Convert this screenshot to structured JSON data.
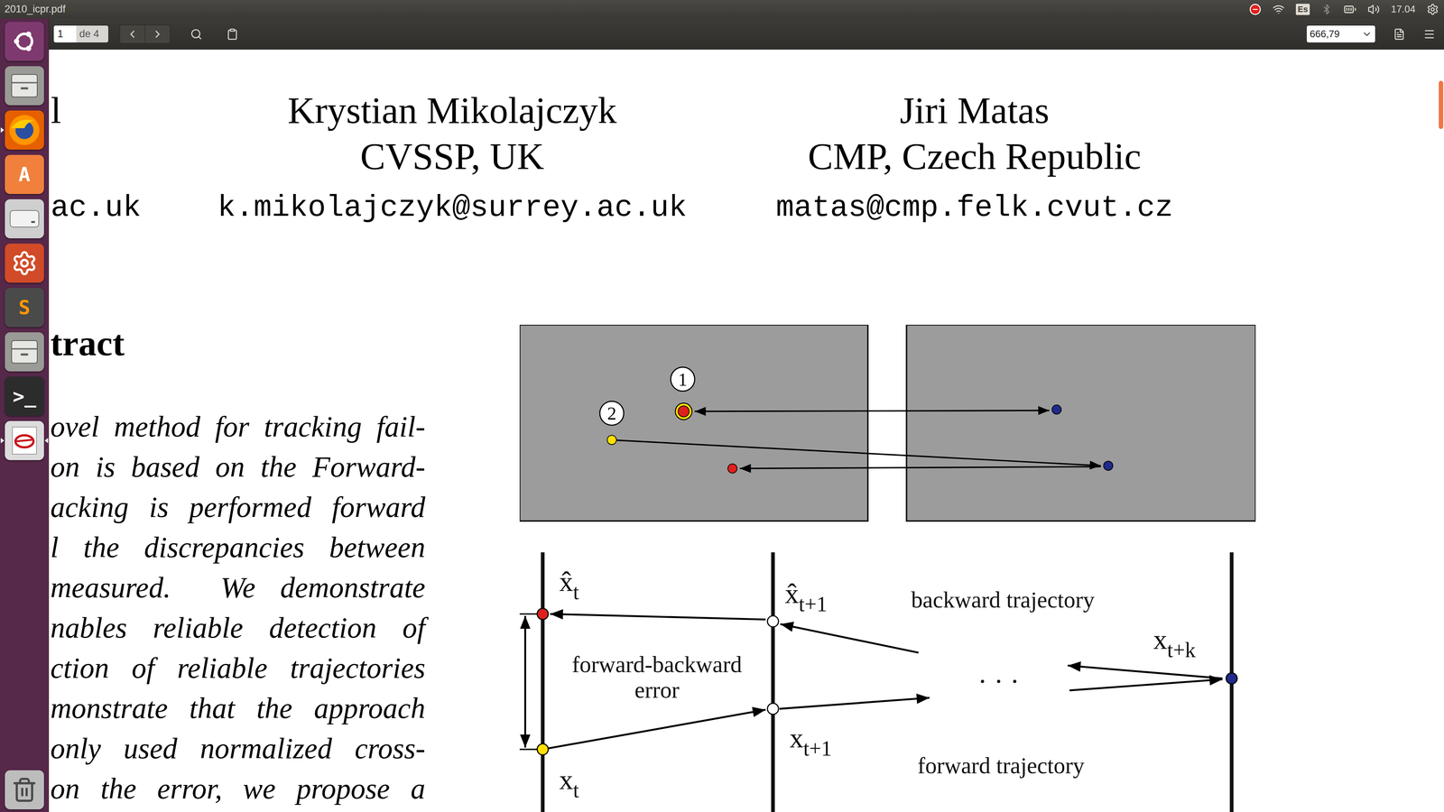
{
  "window": {
    "title": "2010_icpr.pdf"
  },
  "panel": {
    "keyboard": "Es",
    "time": "17.04"
  },
  "toolbar": {
    "page": "1",
    "page_count": "de 4",
    "zoom": "666,79"
  },
  "launcher": [
    {
      "kind": "dash",
      "color": "#7e3a6e",
      "running": false,
      "active": false
    },
    {
      "kind": "files",
      "color": "#9a9a96",
      "running": false,
      "active": false
    },
    {
      "kind": "firefox",
      "color": "#e66000",
      "running": true,
      "active": false
    },
    {
      "kind": "software",
      "color": "#f0803c",
      "glyph": "A",
      "running": false,
      "active": false
    },
    {
      "kind": "drive",
      "color": "#cfcfcf",
      "running": false,
      "active": false
    },
    {
      "kind": "settings",
      "color": "#d14b28",
      "running": false,
      "active": false
    },
    {
      "kind": "sublime",
      "color": "#4a4a4a",
      "glyph": "S",
      "running": false,
      "active": false
    },
    {
      "kind": "files",
      "color": "#9a9a96",
      "running": false,
      "active": false
    },
    {
      "kind": "terminal",
      "color": "#2c2c2c",
      "glyph": ">_",
      "running": false,
      "active": false
    },
    {
      "kind": "viewer",
      "color": "#dcdcdc",
      "running": true,
      "active": true
    },
    {
      "kind": "trash",
      "color": "#bdbdbd",
      "running": false,
      "active": false
    }
  ],
  "document": {
    "authors": [
      {
        "name": "l",
        "email": "ac.uk"
      },
      {
        "name": "Krystian Mikolajczyk",
        "affiliation": "CVSSP, UK",
        "email": "k.mikolajczyk@surrey.ac.uk"
      },
      {
        "name": "Jiri Matas",
        "affiliation": "CMP, Czech Republic",
        "email": "matas@cmp.felk.cvut.cz"
      }
    ],
    "abstract_heading": "tract",
    "abstract_lines": [
      "ovel method for tracking fail-",
      "on is based on the Forward-",
      "acking is performed forward",
      "l the discrepancies between",
      "measured.  We demonstrate",
      "nables reliable detection of",
      "ction of reliable trajectories",
      "monstrate that the approach",
      "only used normalized cross-",
      "on the error, we propose a"
    ],
    "figure": {
      "photo_labels": [
        "1",
        "2"
      ],
      "photo_points": [
        {
          "color": "#e0201c",
          "ring": "#ffe000"
        },
        {
          "color": "#ffe000"
        },
        {
          "color": "#e0201c"
        },
        {
          "color": "#1f2a8a"
        },
        {
          "color": "#1f2a8a"
        }
      ],
      "diagram_points": [
        {
          "base": "x̂",
          "sub": "t",
          "color": "#e0201c"
        },
        {
          "base": "x",
          "sub": "t",
          "color": "#ffe000"
        },
        {
          "base": "x̂",
          "sub": "t+1",
          "color": "#ffffff"
        },
        {
          "base": "x",
          "sub": "t+1",
          "color": "#ffffff"
        },
        {
          "base": "x",
          "sub": "t+k",
          "color": "#1f2a8a"
        }
      ],
      "error_label": [
        "forward-backward",
        "error"
      ],
      "backward_label": "backward trajectory",
      "forward_label": "forward trajectory",
      "ellipsis": "· · ·"
    }
  }
}
